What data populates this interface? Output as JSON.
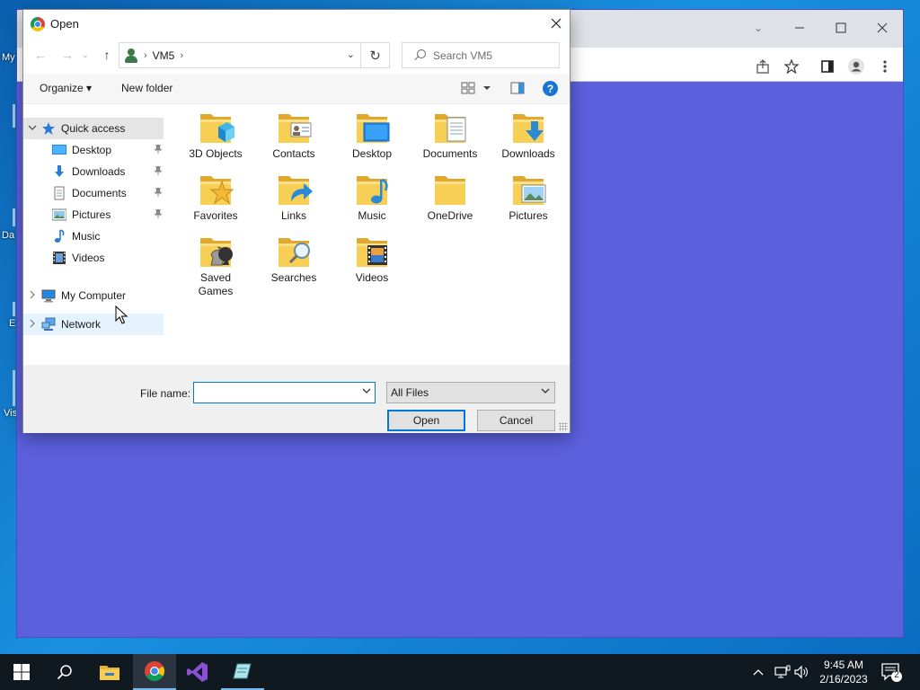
{
  "dialog": {
    "title": "Open",
    "close_glyph": "✕",
    "nav": {
      "back": "←",
      "forward": "→",
      "recent": "⌄",
      "up": "↑"
    },
    "address": {
      "location_icon": "user-icon",
      "crumb": "VM5",
      "sep": "›",
      "dropdown": "⌄"
    },
    "refresh_glyph": "↻",
    "search": {
      "placeholder": "Search VM5"
    },
    "toolbar": {
      "organize": "Organize ▾",
      "new_folder": "New folder",
      "help": "?"
    },
    "navpane": {
      "quick_access": "Quick access",
      "quick_items": [
        {
          "label": "Desktop",
          "pinned": true,
          "icon": "desktop-icon"
        },
        {
          "label": "Downloads",
          "pinned": true,
          "icon": "download-icon"
        },
        {
          "label": "Documents",
          "pinned": true,
          "icon": "document-icon"
        },
        {
          "label": "Pictures",
          "pinned": true,
          "icon": "pictures-icon"
        },
        {
          "label": "Music",
          "pinned": false,
          "icon": "music-icon"
        },
        {
          "label": "Videos",
          "pinned": false,
          "icon": "video-icon"
        }
      ],
      "my_computer": "My Computer",
      "network": "Network"
    },
    "files": [
      {
        "label": "3D Objects",
        "icon": "3d-objects-icon"
      },
      {
        "label": "Contacts",
        "icon": "contacts-icon"
      },
      {
        "label": "Desktop",
        "icon": "desktop-icon"
      },
      {
        "label": "Documents",
        "icon": "documents-icon"
      },
      {
        "label": "Downloads",
        "icon": "downloads-icon"
      },
      {
        "label": "Favorites",
        "icon": "favorites-icon"
      },
      {
        "label": "Links",
        "icon": "links-icon"
      },
      {
        "label": "Music",
        "icon": "music-icon"
      },
      {
        "label": "OneDrive",
        "icon": "onedrive-icon"
      },
      {
        "label": "Pictures",
        "icon": "pictures-icon"
      },
      {
        "label": "Saved Games",
        "icon": "saved-games-icon"
      },
      {
        "label": "Searches",
        "icon": "searches-icon"
      },
      {
        "label": "Videos",
        "icon": "videos-icon"
      }
    ],
    "bottom": {
      "file_name_label": "File name:",
      "file_name_value": "",
      "file_type": "All Files",
      "open_button": "Open",
      "cancel_button": "Cancel"
    }
  },
  "desktop": {
    "labels": [
      "My",
      "Da",
      "E",
      "Vis"
    ]
  },
  "taskbar": {
    "apps": [
      "start-icon",
      "search-icon",
      "file-explorer-icon",
      "chrome-icon",
      "visual-studio-icon",
      "notepad-icon"
    ],
    "time": "9:45 AM",
    "date": "2/16/2023",
    "notification_count": "2"
  },
  "colors": {
    "chrome_content": "#5b60dd",
    "accent": "#0078d7",
    "folder": "#f5c842"
  }
}
